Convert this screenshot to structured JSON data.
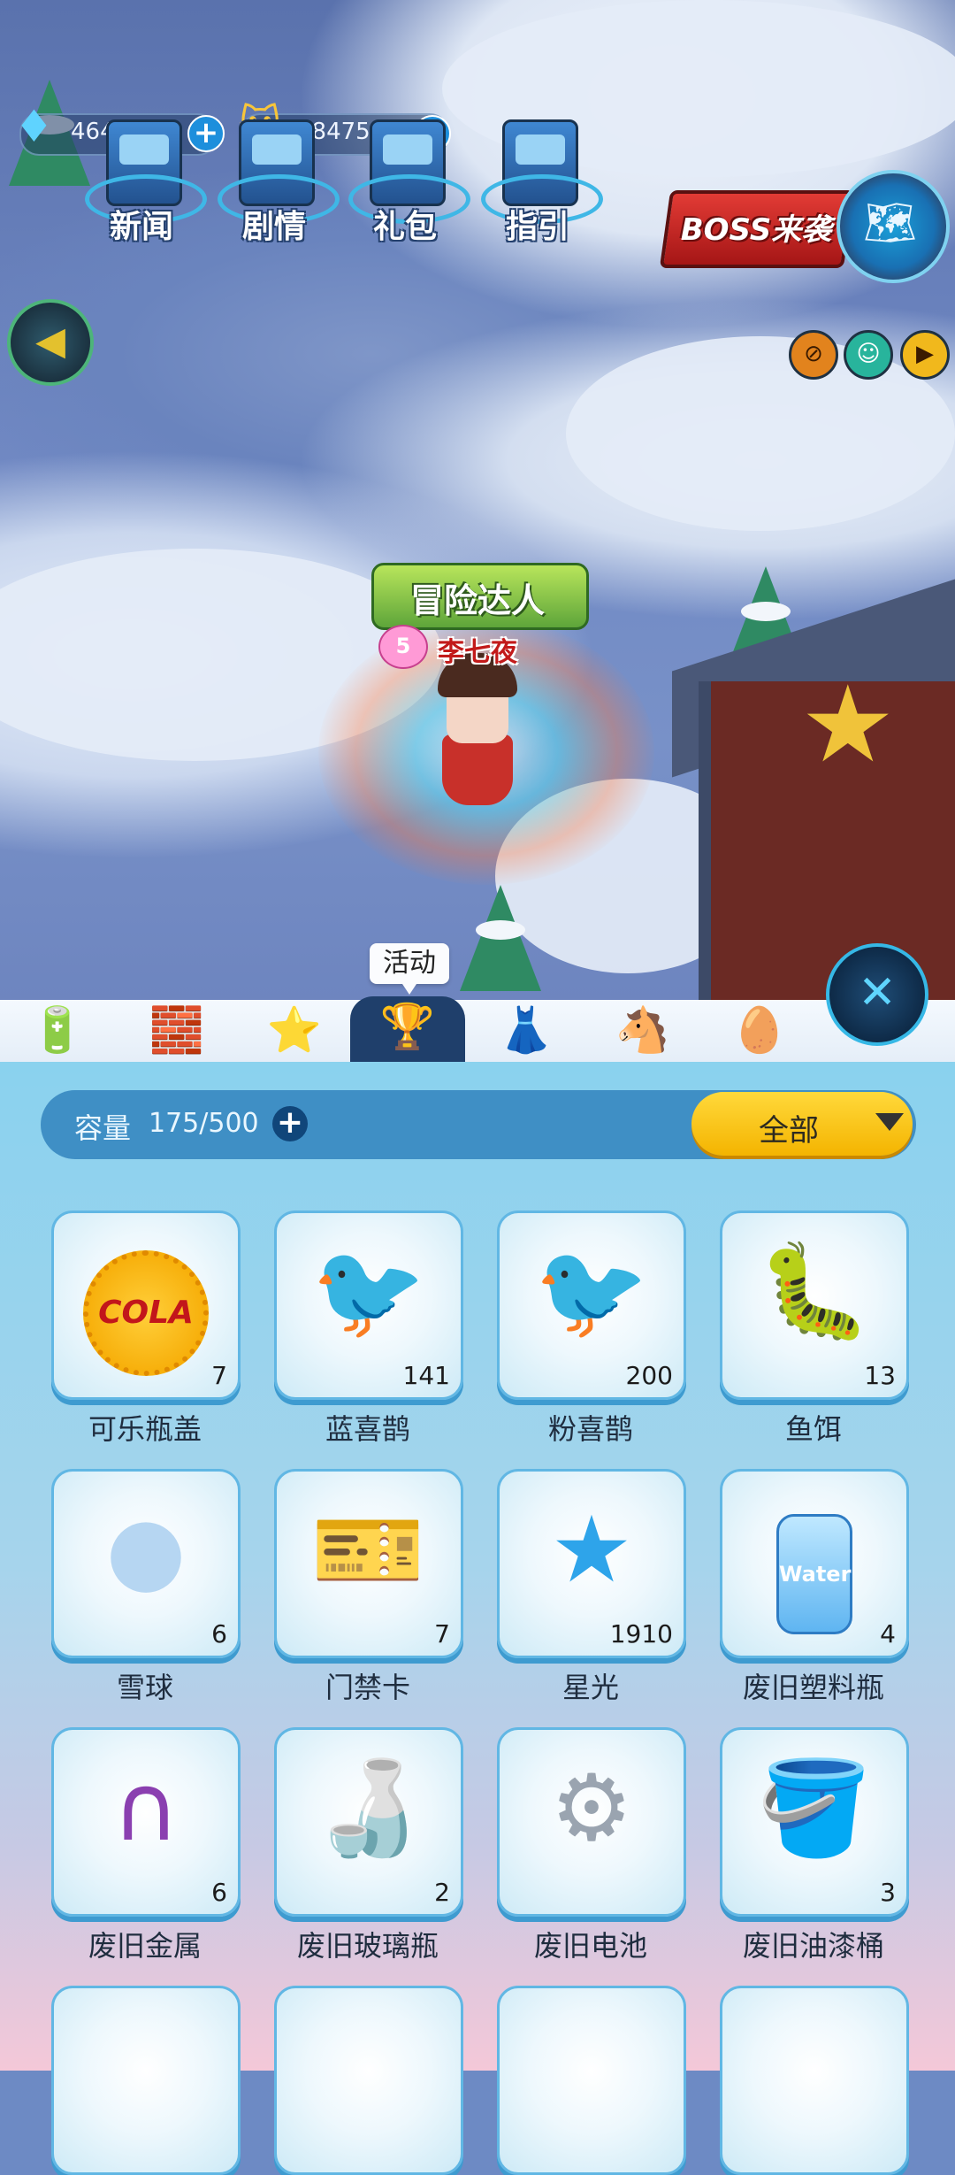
{
  "hud": {
    "gems": "464",
    "coins": "484750",
    "menu": [
      "新闻",
      "剧情",
      "礼包",
      "指引"
    ],
    "boss_banner": "BOSS来袭"
  },
  "scene": {
    "title_banner": "冒险达人",
    "player_name": "李七夜",
    "pet_level": "5"
  },
  "tabs": {
    "tooltip": "活动",
    "active_index": 3,
    "icons": [
      "battery-icon",
      "blocks-icon",
      "magic-wand-icon",
      "trophy-star-icon",
      "dress-icon",
      "rocking-horse-icon",
      "egg-icon"
    ]
  },
  "inventory": {
    "capacity_label": "容量",
    "capacity_value": "175/500",
    "filter_selected": "全部",
    "items": [
      {
        "name": "可乐瓶盖",
        "count": "7",
        "icon": "cola-cap-icon"
      },
      {
        "name": "蓝喜鹊",
        "count": "141",
        "icon": "blue-bird-icon"
      },
      {
        "name": "粉喜鹊",
        "count": "200",
        "icon": "pink-bird-icon"
      },
      {
        "name": "鱼饵",
        "count": "13",
        "icon": "worm-bait-icon"
      },
      {
        "name": "雪球",
        "count": "6",
        "icon": "snowball-icon"
      },
      {
        "name": "门禁卡",
        "count": "7",
        "icon": "access-card-icon"
      },
      {
        "name": "星光",
        "count": "1910",
        "icon": "star-crystal-icon"
      },
      {
        "name": "废旧塑料瓶",
        "count": "4",
        "icon": "water-bottle-icon"
      },
      {
        "name": "废旧金属",
        "count": "6",
        "icon": "magnet-icon"
      },
      {
        "name": "废旧玻璃瓶",
        "count": "2",
        "icon": "glass-bottle-icon"
      },
      {
        "name": "废旧电池",
        "count": "",
        "icon": "battery-gear-icon"
      },
      {
        "name": "废旧油漆桶",
        "count": "3",
        "icon": "paint-bucket-icon"
      }
    ],
    "water_label": "Water",
    "cola_label": "COLA"
  }
}
